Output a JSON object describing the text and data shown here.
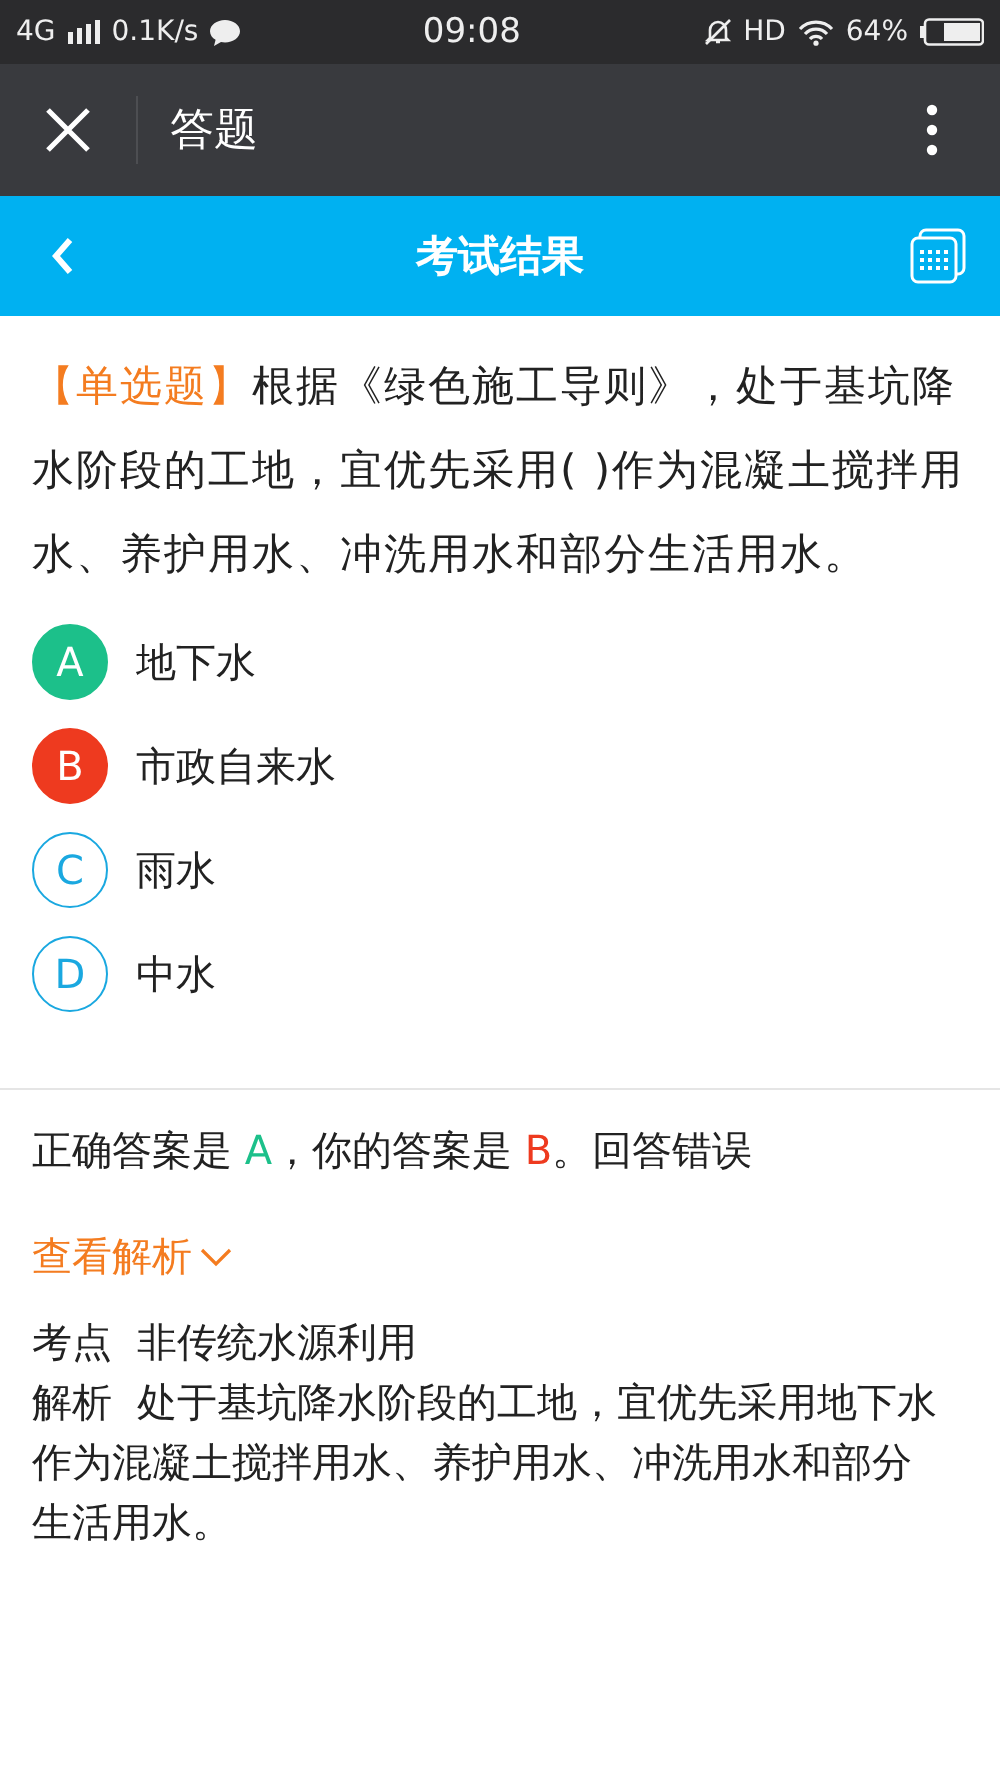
{
  "status_bar": {
    "network": "4G",
    "speed": "0.1K/s",
    "time": "09:08",
    "hd": "HD",
    "battery": "64%"
  },
  "app_bar": {
    "title": "答题"
  },
  "header": {
    "title": "考试结果"
  },
  "question": {
    "type_label": "【单选题】",
    "text": "根据《绿色施工导则》，处于基坑降水阶段的工地，宜优先采用( )作为混凝土搅拌用水、养护用水、冲洗用水和部分生活用水。"
  },
  "options": [
    {
      "letter": "A",
      "text": "地下水",
      "kind": "correct"
    },
    {
      "letter": "B",
      "text": "市政自来水",
      "kind": "wrong"
    },
    {
      "letter": "C",
      "text": "雨水",
      "kind": "plain"
    },
    {
      "letter": "D",
      "text": "中水",
      "kind": "plain"
    }
  ],
  "result": {
    "correct_prefix": "正确答案是 ",
    "correct": "A",
    "middle": "，你的答案是 ",
    "yours": "B",
    "suffix": "。回答错误"
  },
  "analysis_toggle": {
    "label": "查看解析",
    "expanded": true
  },
  "analysis": [
    {
      "label": "考点",
      "text": "非传统水源利用"
    },
    {
      "label": "解析",
      "text": "处于基坑降水阶段的工地，宜优先采用地下水作为混凝土搅拌用水、养护用水、冲洗用水和部分生活用水。"
    }
  ]
}
